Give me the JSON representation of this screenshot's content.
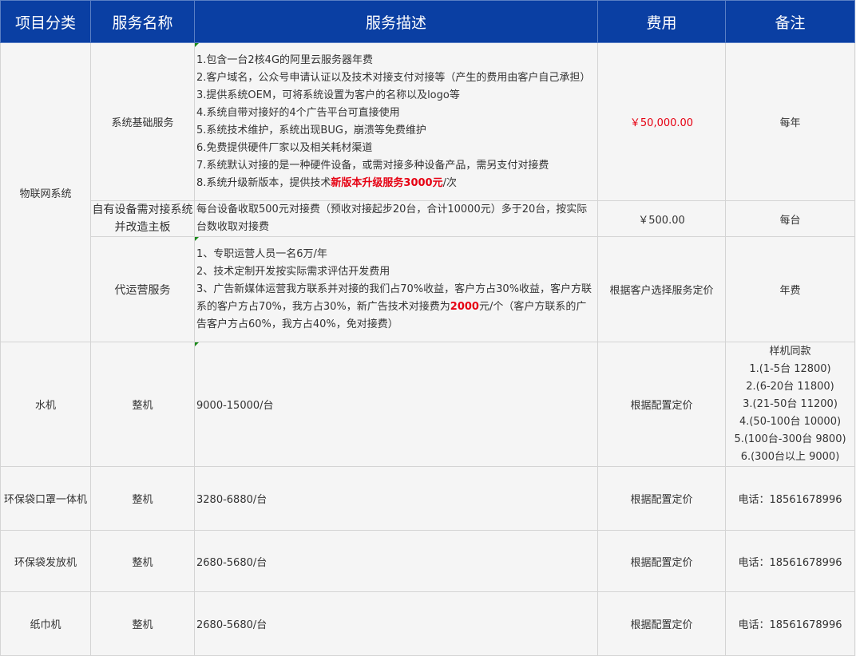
{
  "headers": {
    "category": "项目分类",
    "service": "服务名称",
    "desc": "服务描述",
    "fee": "费用",
    "note": "备注"
  },
  "iot": {
    "category": "物联网系统",
    "basic": {
      "name": "系统基础服务",
      "lines": [
        "1.包含一台2核4G的阿里云服务器年费",
        "2.客户域名，公众号申请认证以及技术对接支付对接等（产生的费用由客户自己承担）",
        "3.提供系统OEM，可将系统设置为客户的名称以及logo等",
        "4.系统自带对接好的4个广告平台可直接使用",
        "5.系统技术维护，系统出现BUG，崩溃等免费维护",
        "6.免费提供硬件厂家以及相关耗材渠道",
        "7.系统默认对接的是一种硬件设备，或需对接多种设备产品，需另支付对接费"
      ],
      "line8_pre": "8.系统升级新版本，提供技术",
      "line8_red": "新版本升级服务3000元",
      "line8_post": "/次",
      "fee": "￥50,000.00",
      "note": "每年"
    },
    "device": {
      "name": "自有设备需对接系统并改造主板",
      "desc": "每台设备收取500元对接费（预收对接起步20台，合计10000元）多于20台，按实际台数收取对接费",
      "fee": "￥500.00",
      "note": "每台"
    },
    "ops": {
      "name": "代运营服务",
      "line1": "1、专职运营人员一名6万/年",
      "line2": "2、技术定制开发按实际需求评估开发费用",
      "line3_pre": "3、广告新媒体运营我方联系并对接的我们占70%收益，客户方占30%收益，客户方联系的客户方占70%，我方占30%，新广告技术对接费为",
      "line3_red": "2000",
      "line3_post": "元/个（客户方联系的广告客户方占60%，我方占40%，免对接费）",
      "fee": "根据客户选择服务定价",
      "note": "年费"
    }
  },
  "water": {
    "category": "水机",
    "name": "整机",
    "desc": "9000-15000/台",
    "fee": "根据配置定价",
    "notes": [
      "样机同款",
      "1.(1-5台 12800)",
      "2.(6-20台 11800)",
      "3.(21-50台 11200)",
      "4.(50-100台 10000)",
      "5.(100台-300台 9800)",
      "6.(300台以上 9000)"
    ]
  },
  "bag_mask": {
    "category": "环保袋口罩一体机",
    "name": "整机",
    "desc": "3280-6880/台",
    "fee": "根据配置定价",
    "note": "电话：18561678996"
  },
  "bag": {
    "category": "环保袋发放机",
    "name": "整机",
    "desc": "2680-5680/台",
    "fee": "根据配置定价",
    "note": "电话：18561678996"
  },
  "tissue": {
    "category": "纸巾机",
    "name": "整机",
    "desc": "2680-5680/台",
    "fee": "根据配置定价",
    "note": "电话：18561678996"
  }
}
